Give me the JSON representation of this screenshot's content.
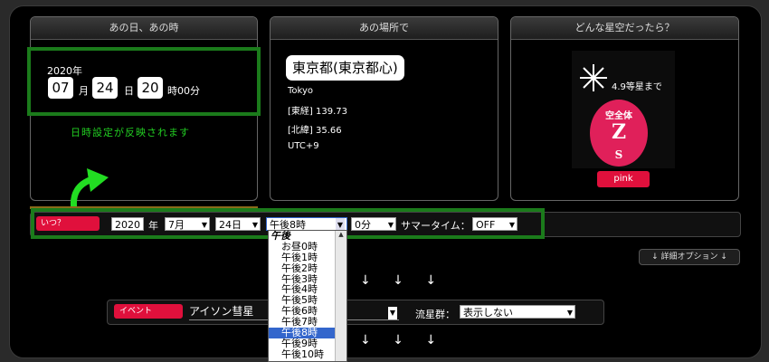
{
  "cards": {
    "datetime": {
      "header": "あの日、あの時",
      "year": "2020年",
      "month": "07",
      "month_unit": "月",
      "day": "24",
      "day_unit": "日",
      "hour": "20",
      "hour_minute_unit": "時00分",
      "annotation": "日時設定が反映されます"
    },
    "place": {
      "header": "あの場所で",
      "name": "東京都(東京都心)",
      "city": "Tokyo",
      "longitude": "[東経] 139.73",
      "latitude": "[北緯] 35.66",
      "timezone": "UTC+9"
    },
    "sky": {
      "header": "どんな星空だったら？",
      "magnitude": "4.9等星まで",
      "badge_top": "空全体",
      "badge_letter": "Z",
      "badge_bottom": "S",
      "color_button": "pink"
    }
  },
  "when_row": {
    "label": "いつ？",
    "year_value": "2020",
    "year_unit": "年",
    "month_select": "7月",
    "day_select": "24日",
    "hour_select": "午後8時",
    "minute_select": "0分",
    "summer_time_label": "サマータイム：",
    "summer_time_select": "OFF"
  },
  "hour_dropdown": {
    "options": [
      "午後",
      "お昼0時",
      "午後1時",
      "午後2時",
      "午後3時",
      "午後4時",
      "午後5時",
      "午後6時",
      "午後7時",
      "午後8時",
      "午後9時",
      "午後10時"
    ],
    "selected": "午後8時"
  },
  "details_button": "↓ 詳細オプション ↓",
  "arrows_1": "↓ ↓ ↓",
  "arrows_2": "↓ ↓ ↓",
  "event_row": {
    "label": "イベント",
    "event_value": "アイソン彗星",
    "meteor_label": "流星群：",
    "meteor_select": "表示しない"
  },
  "colors": {
    "accent_red": "#e0103c",
    "highlight_green": "#1b7b1b",
    "annotation_green": "#22cc22",
    "arrow_green": "#22dd22"
  }
}
